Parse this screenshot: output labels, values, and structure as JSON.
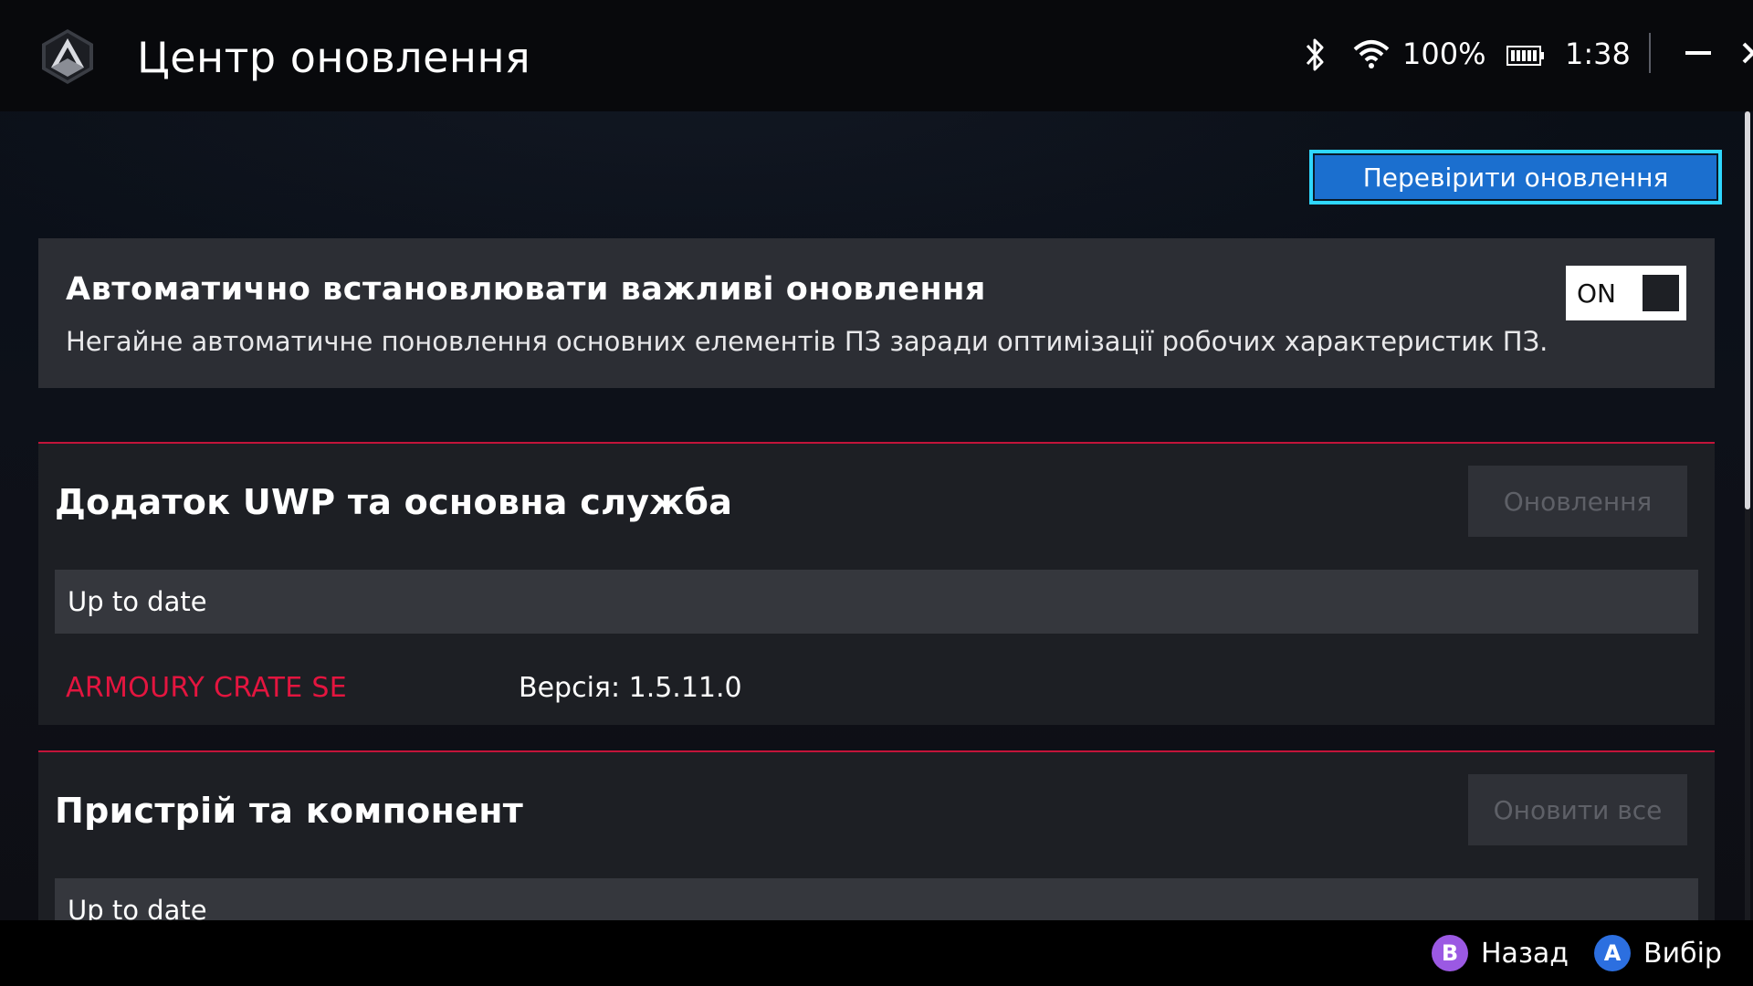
{
  "window": {
    "title": "Центр оновлення",
    "logo_icon": "rog-ally-logo"
  },
  "status_bar": {
    "bluetooth_icon": "bluetooth-icon",
    "wifi_icon": "wifi-icon",
    "battery_percent": "100%",
    "battery_icon": "battery-full-icon",
    "time": "1:38",
    "minimize_icon": "minimize-icon",
    "close_icon": "close-icon"
  },
  "toolbar": {
    "check_updates_label": "Перевірити оновлення"
  },
  "auto_install": {
    "title": "Автоматично встановлювати важливі оновлення",
    "description": "Негайне автоматичне поновлення основних елементів ПЗ заради оптимізації робочих характеристик ПЗ.",
    "toggle_label": "ON",
    "toggle_on": true
  },
  "sections": [
    {
      "title": "Додаток UWP та основна служба",
      "button_label": "Оновлення",
      "status": "Up to date",
      "items": [
        {
          "name": "ARMOURY CRATE SE",
          "version": "Версія: 1.5.11.0"
        }
      ]
    },
    {
      "title": "Пристрій та компонент",
      "button_label": "Оновити все",
      "status": "Up to date"
    }
  ],
  "bottom_hints": {
    "back_key": "B",
    "back_label": "Назад",
    "select_key": "A",
    "select_label": "Вибір"
  },
  "colors": {
    "accent_red": "#e3153f",
    "button_blue": "#1b6fcf",
    "focus_cyan": "#2fd7ff",
    "b_button": "#9b59e3",
    "a_button": "#2c6fe0"
  }
}
